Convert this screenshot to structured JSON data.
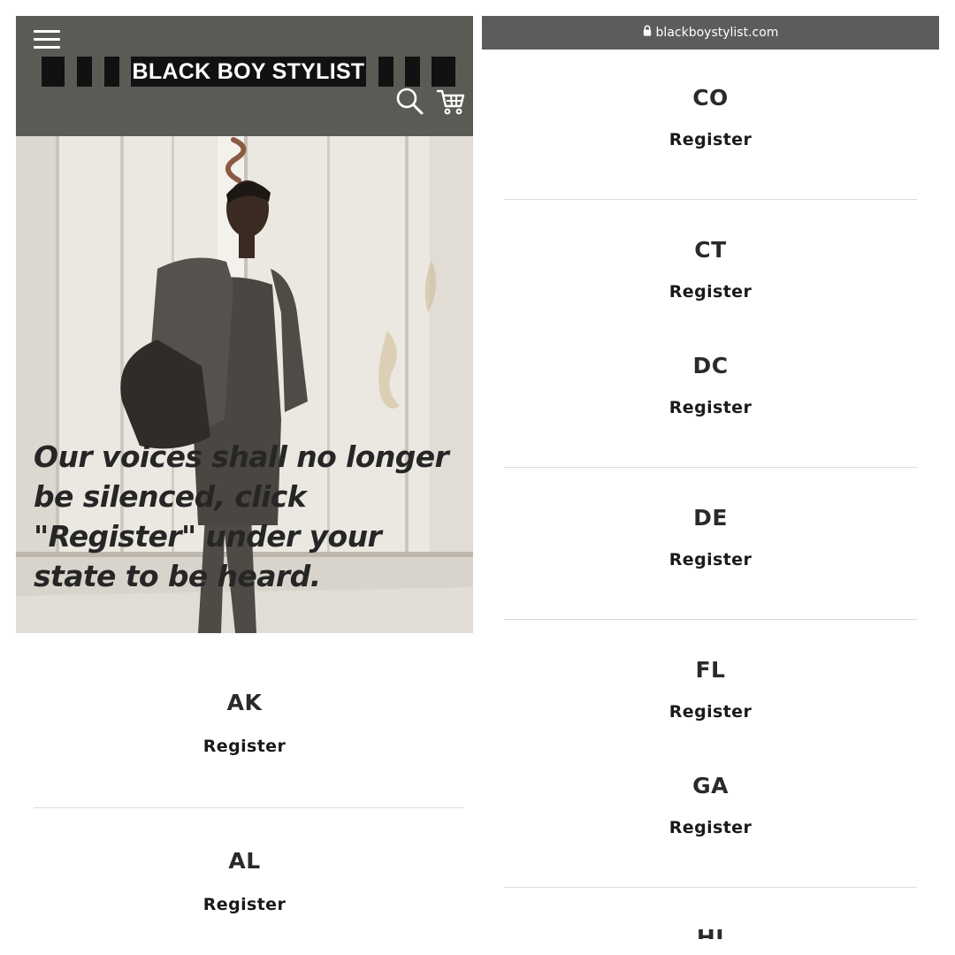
{
  "header": {
    "logo_text": "BLACK BOY STYLIST",
    "menu_icon": "hamburger-menu-icon",
    "search_icon": "search-icon",
    "cart_icon": "cart-icon",
    "background_color": "#5b5b56"
  },
  "hero": {
    "message": "Our voices shall no longer be silenced, click \"Register\" under your state to be heard."
  },
  "left_states": [
    {
      "code": "AK",
      "link": "Register"
    },
    {
      "code": "AL",
      "link": "Register"
    }
  ],
  "browser": {
    "url": "blackboystylist.com",
    "lock_icon": "lock-icon"
  },
  "right_states": [
    {
      "code": "CO",
      "link": "Register"
    },
    {
      "code": "CT",
      "link": "Register"
    },
    {
      "code": "DC",
      "link": "Register"
    },
    {
      "code": "DE",
      "link": "Register"
    },
    {
      "code": "FL",
      "link": "Register"
    },
    {
      "code": "GA",
      "link": "Register"
    },
    {
      "code": "HI",
      "link": ""
    }
  ]
}
